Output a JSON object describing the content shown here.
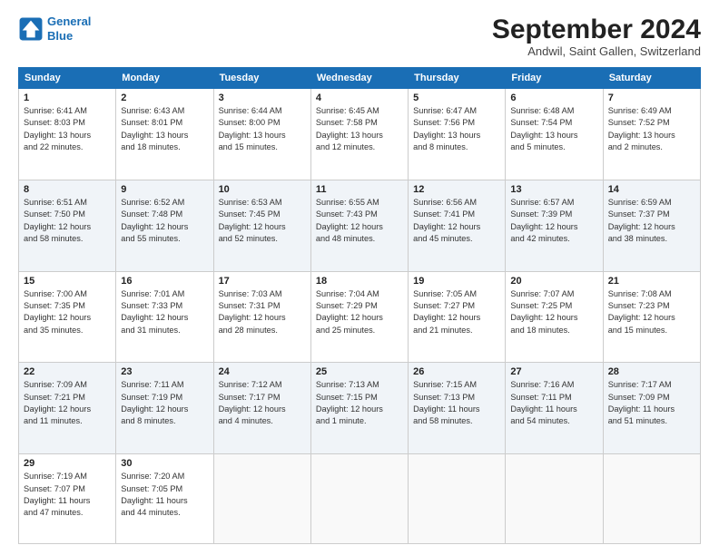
{
  "logo": {
    "line1": "General",
    "line2": "Blue"
  },
  "title": "September 2024",
  "location": "Andwil, Saint Gallen, Switzerland",
  "weekdays": [
    "Sunday",
    "Monday",
    "Tuesday",
    "Wednesday",
    "Thursday",
    "Friday",
    "Saturday"
  ],
  "rows": [
    [
      {
        "day": "1",
        "info": "Sunrise: 6:41 AM\nSunset: 8:03 PM\nDaylight: 13 hours\nand 22 minutes."
      },
      {
        "day": "2",
        "info": "Sunrise: 6:43 AM\nSunset: 8:01 PM\nDaylight: 13 hours\nand 18 minutes."
      },
      {
        "day": "3",
        "info": "Sunrise: 6:44 AM\nSunset: 8:00 PM\nDaylight: 13 hours\nand 15 minutes."
      },
      {
        "day": "4",
        "info": "Sunrise: 6:45 AM\nSunset: 7:58 PM\nDaylight: 13 hours\nand 12 minutes."
      },
      {
        "day": "5",
        "info": "Sunrise: 6:47 AM\nSunset: 7:56 PM\nDaylight: 13 hours\nand 8 minutes."
      },
      {
        "day": "6",
        "info": "Sunrise: 6:48 AM\nSunset: 7:54 PM\nDaylight: 13 hours\nand 5 minutes."
      },
      {
        "day": "7",
        "info": "Sunrise: 6:49 AM\nSunset: 7:52 PM\nDaylight: 13 hours\nand 2 minutes."
      }
    ],
    [
      {
        "day": "8",
        "info": "Sunrise: 6:51 AM\nSunset: 7:50 PM\nDaylight: 12 hours\nand 58 minutes."
      },
      {
        "day": "9",
        "info": "Sunrise: 6:52 AM\nSunset: 7:48 PM\nDaylight: 12 hours\nand 55 minutes."
      },
      {
        "day": "10",
        "info": "Sunrise: 6:53 AM\nSunset: 7:45 PM\nDaylight: 12 hours\nand 52 minutes."
      },
      {
        "day": "11",
        "info": "Sunrise: 6:55 AM\nSunset: 7:43 PM\nDaylight: 12 hours\nand 48 minutes."
      },
      {
        "day": "12",
        "info": "Sunrise: 6:56 AM\nSunset: 7:41 PM\nDaylight: 12 hours\nand 45 minutes."
      },
      {
        "day": "13",
        "info": "Sunrise: 6:57 AM\nSunset: 7:39 PM\nDaylight: 12 hours\nand 42 minutes."
      },
      {
        "day": "14",
        "info": "Sunrise: 6:59 AM\nSunset: 7:37 PM\nDaylight: 12 hours\nand 38 minutes."
      }
    ],
    [
      {
        "day": "15",
        "info": "Sunrise: 7:00 AM\nSunset: 7:35 PM\nDaylight: 12 hours\nand 35 minutes."
      },
      {
        "day": "16",
        "info": "Sunrise: 7:01 AM\nSunset: 7:33 PM\nDaylight: 12 hours\nand 31 minutes."
      },
      {
        "day": "17",
        "info": "Sunrise: 7:03 AM\nSunset: 7:31 PM\nDaylight: 12 hours\nand 28 minutes."
      },
      {
        "day": "18",
        "info": "Sunrise: 7:04 AM\nSunset: 7:29 PM\nDaylight: 12 hours\nand 25 minutes."
      },
      {
        "day": "19",
        "info": "Sunrise: 7:05 AM\nSunset: 7:27 PM\nDaylight: 12 hours\nand 21 minutes."
      },
      {
        "day": "20",
        "info": "Sunrise: 7:07 AM\nSunset: 7:25 PM\nDaylight: 12 hours\nand 18 minutes."
      },
      {
        "day": "21",
        "info": "Sunrise: 7:08 AM\nSunset: 7:23 PM\nDaylight: 12 hours\nand 15 minutes."
      }
    ],
    [
      {
        "day": "22",
        "info": "Sunrise: 7:09 AM\nSunset: 7:21 PM\nDaylight: 12 hours\nand 11 minutes."
      },
      {
        "day": "23",
        "info": "Sunrise: 7:11 AM\nSunset: 7:19 PM\nDaylight: 12 hours\nand 8 minutes."
      },
      {
        "day": "24",
        "info": "Sunrise: 7:12 AM\nSunset: 7:17 PM\nDaylight: 12 hours\nand 4 minutes."
      },
      {
        "day": "25",
        "info": "Sunrise: 7:13 AM\nSunset: 7:15 PM\nDaylight: 12 hours\nand 1 minute."
      },
      {
        "day": "26",
        "info": "Sunrise: 7:15 AM\nSunset: 7:13 PM\nDaylight: 11 hours\nand 58 minutes."
      },
      {
        "day": "27",
        "info": "Sunrise: 7:16 AM\nSunset: 7:11 PM\nDaylight: 11 hours\nand 54 minutes."
      },
      {
        "day": "28",
        "info": "Sunrise: 7:17 AM\nSunset: 7:09 PM\nDaylight: 11 hours\nand 51 minutes."
      }
    ],
    [
      {
        "day": "29",
        "info": "Sunrise: 7:19 AM\nSunset: 7:07 PM\nDaylight: 11 hours\nand 47 minutes."
      },
      {
        "day": "30",
        "info": "Sunrise: 7:20 AM\nSunset: 7:05 PM\nDaylight: 11 hours\nand 44 minutes."
      },
      {
        "day": "",
        "info": ""
      },
      {
        "day": "",
        "info": ""
      },
      {
        "day": "",
        "info": ""
      },
      {
        "day": "",
        "info": ""
      },
      {
        "day": "",
        "info": ""
      }
    ]
  ]
}
